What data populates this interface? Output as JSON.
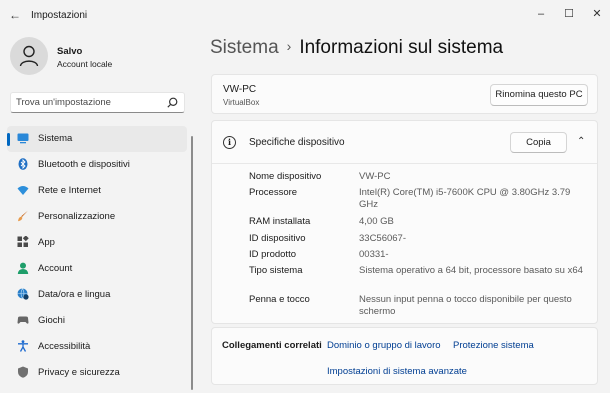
{
  "app": {
    "title": "Impostazioni"
  },
  "user": {
    "name": "Salvo",
    "account_type": "Account locale"
  },
  "search": {
    "placeholder": "Trova un'impostazione"
  },
  "sidebar": {
    "items": [
      {
        "label": "Sistema",
        "icon": "system-icon",
        "active": true
      },
      {
        "label": "Bluetooth e dispositivi",
        "icon": "bluetooth-icon"
      },
      {
        "label": "Rete e Internet",
        "icon": "wifi-icon"
      },
      {
        "label": "Personalizzazione",
        "icon": "brush-icon"
      },
      {
        "label": "App",
        "icon": "apps-icon"
      },
      {
        "label": "Account",
        "icon": "account-icon"
      },
      {
        "label": "Data/ora e lingua",
        "icon": "globe-clock-icon"
      },
      {
        "label": "Giochi",
        "icon": "gamepad-icon"
      },
      {
        "label": "Accessibilità",
        "icon": "accessibility-icon"
      },
      {
        "label": "Privacy e sicurezza",
        "icon": "shield-icon"
      }
    ]
  },
  "breadcrumb": {
    "parent": "Sistema",
    "separator": "›",
    "current": "Informazioni sul sistema"
  },
  "device": {
    "name": "VW-PC",
    "model": "VirtualBox",
    "rename_label": "Rinomina questo PC"
  },
  "specs": {
    "title": "Specifiche dispositivo",
    "copy_label": "Copia",
    "rows": [
      {
        "key": "Nome dispositivo",
        "value": "VW-PC"
      },
      {
        "key": "Processore",
        "value": "Intel(R) Core(TM) i5-7600K CPU @ 3.80GHz   3.79 GHz"
      },
      {
        "key": "RAM installata",
        "value": "4,00 GB"
      },
      {
        "key": "ID dispositivo",
        "value": "33C56067-"
      },
      {
        "key": "ID prodotto",
        "value": "00331-"
      },
      {
        "key": "Tipo sistema",
        "value": "Sistema operativo a 64 bit, processore basato su x64"
      },
      {
        "key": "Penna e tocco",
        "value": "Nessun input penna o tocco disponibile per questo schermo"
      }
    ]
  },
  "related": {
    "title": "Collegamenti correlati",
    "links": [
      "Dominio o gruppo di lavoro",
      "Protezione sistema",
      "Impostazioni di sistema avanzate"
    ]
  },
  "colors": {
    "accent": "#0067c0",
    "link": "#003e92",
    "background": "#f3f3f3",
    "card": "#fbfbfb"
  }
}
